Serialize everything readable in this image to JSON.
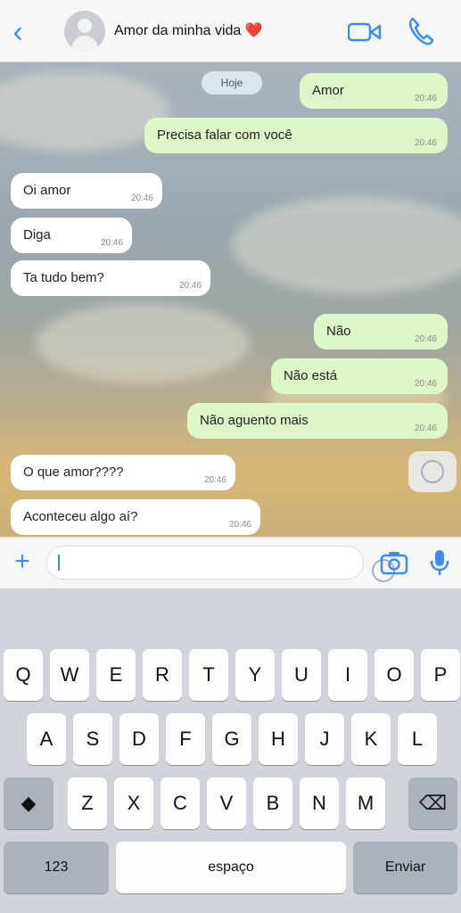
{
  "header": {
    "back_icon": "chevron-left-icon",
    "contact_name": "Amor da minha vida",
    "contact_emoji": "❤️",
    "video_icon": "video-camera-icon",
    "call_icon": "phone-icon"
  },
  "chat": {
    "date_label": "Hoje",
    "messages": [
      {
        "dir": "out",
        "text": "Amor",
        "time": "20:46"
      },
      {
        "dir": "out",
        "text": "Precisa falar com você",
        "time": "20:46"
      },
      {
        "dir": "in",
        "text": "Oi amor",
        "time": "20:46"
      },
      {
        "dir": "in",
        "text": "Diga",
        "time": "20:46"
      },
      {
        "dir": "in",
        "text": "Ta tudo bem?",
        "time": "20:46"
      },
      {
        "dir": "out",
        "text": "Não",
        "time": "20:46"
      },
      {
        "dir": "out",
        "text": "Não está",
        "time": "20:46"
      },
      {
        "dir": "out",
        "text": "Não aguento mais",
        "time": "20:46"
      },
      {
        "dir": "in",
        "text": "O que amor????",
        "time": "20:46"
      },
      {
        "dir": "in",
        "text": "Aconteceu algo aí?",
        "time": "20:46"
      }
    ]
  },
  "input": {
    "plus_label": "+",
    "plus_icon": "plus-icon",
    "sticker_icon": "sticker-icon",
    "camera_icon": "camera-icon",
    "mic_icon": "microphone-icon"
  },
  "keyboard": {
    "row1": [
      "Q",
      "W",
      "E",
      "R",
      "T",
      "Y",
      "U",
      "I",
      "O",
      "P"
    ],
    "row2": [
      "A",
      "S",
      "D",
      "F",
      "G",
      "H",
      "J",
      "K",
      "L"
    ],
    "row3": [
      "Z",
      "X",
      "C",
      "V",
      "B",
      "N",
      "M"
    ],
    "shift_icon": "shift-icon",
    "backspace_icon": "backspace-icon",
    "numbers_label": "123",
    "space_label": "espaço",
    "return_label": "Enviar"
  },
  "colors": {
    "accent": "#3a8df3",
    "outgoing_bubble": "#dcf8c6",
    "incoming_bubble": "#ffffff",
    "keyboard_bg": "#d1d4da"
  }
}
